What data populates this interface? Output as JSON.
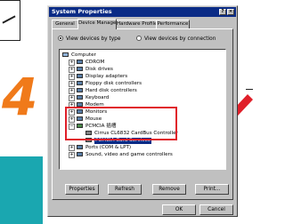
{
  "dialog": {
    "title": "System Properties",
    "help_glyph": "?",
    "close_glyph": "×"
  },
  "tabs": [
    {
      "label": "General",
      "active": false
    },
    {
      "label": "Device Manager",
      "active": true
    },
    {
      "label": "Hardware Profiles",
      "active": false
    },
    {
      "label": "Performance",
      "active": false
    }
  ],
  "view_options": {
    "by_type": "View devices by type",
    "by_connection": "View devices by connection",
    "selected": "by_type"
  },
  "tree": {
    "root": "Computer",
    "items": [
      {
        "label": "CDROM",
        "icon": "cdrom-icon"
      },
      {
        "label": "Disk drives",
        "icon": "disk-drives-icon"
      },
      {
        "label": "Display adapters",
        "icon": "display-adapter-icon"
      },
      {
        "label": "Floppy disk controllers",
        "icon": "floppy-controller-icon"
      },
      {
        "label": "Hard disk controllers",
        "icon": "hard-disk-controller-icon"
      },
      {
        "label": "Keyboard",
        "icon": "keyboard-icon"
      },
      {
        "label": "Modem",
        "icon": "modem-icon"
      },
      {
        "label": "Monitors",
        "icon": "monitor-icon"
      },
      {
        "label": "Mouse",
        "icon": "mouse-icon"
      },
      {
        "label": "PCMCIA 插槽",
        "icon": "pcmcia-socket-icon"
      },
      {
        "label": "Ports (COM & LPT)",
        "icon": "ports-icon"
      },
      {
        "label": "Sound, video and game controllers",
        "icon": "sound-video-icon"
      }
    ],
    "pcmcia_children": [
      {
        "label": "Cirrus CL6832 CardBus Controller",
        "icon": "cardbus-controller-icon"
      },
      {
        "label": "PCMCIA Card Services",
        "icon": "card-services-icon",
        "selected": true
      }
    ]
  },
  "buttons": {
    "properties": "Properties",
    "refresh": "Refresh",
    "remove": "Remove",
    "print": "Print...",
    "ok": "OK",
    "cancel": "Cancel"
  },
  "step": {
    "number": "4"
  },
  "colors": {
    "title_bar": "#0a2b86",
    "highlight_box": "#e0202a",
    "step_number": "#f07a1a",
    "teal_band": "#1aa7b0",
    "window_face": "#c0c0c0"
  }
}
